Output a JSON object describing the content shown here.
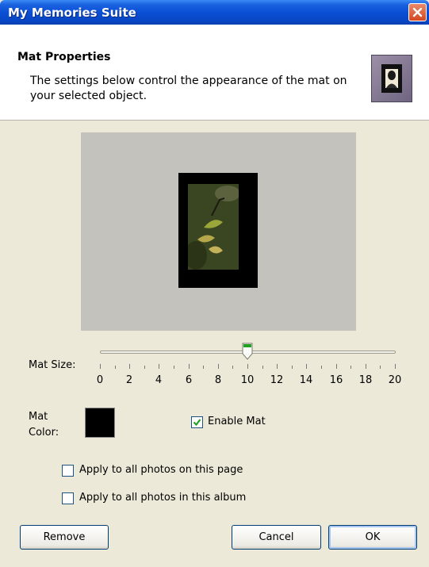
{
  "window": {
    "title": "My Memories Suite"
  },
  "header": {
    "title": "Mat Properties",
    "description": "The settings below control the appearance of the mat on your selected object."
  },
  "mat_size": {
    "label": "Mat Size:",
    "value": 10,
    "min": 0,
    "max": 20,
    "tick_labels": [
      "0",
      "2",
      "4",
      "6",
      "8",
      "10",
      "12",
      "14",
      "16",
      "18",
      "20"
    ]
  },
  "mat_color": {
    "label": "Mat Color:",
    "value": "#000000"
  },
  "enable_mat": {
    "label": "Enable Mat",
    "checked": true
  },
  "apply_page": {
    "label": "Apply to all photos on this page",
    "checked": false
  },
  "apply_album": {
    "label": "Apply to all photos in this album",
    "checked": false
  },
  "buttons": {
    "remove": "Remove",
    "cancel": "Cancel",
    "ok": "OK"
  }
}
